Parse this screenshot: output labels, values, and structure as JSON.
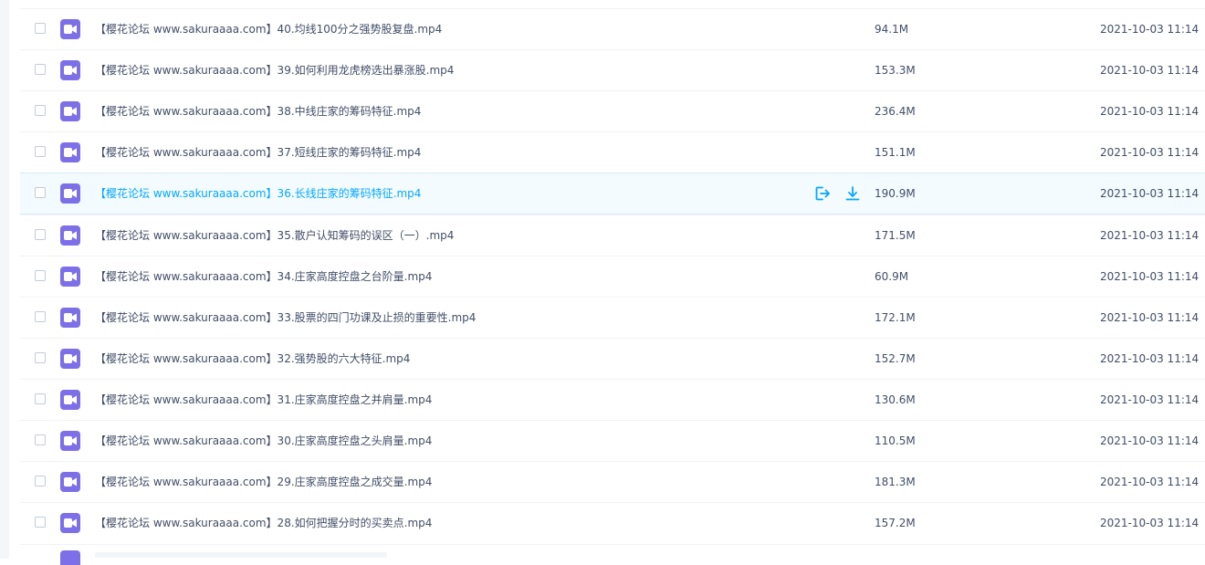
{
  "files": [
    {
      "name": "【樱花论坛 www.sakuraaaa.com】40.均线100分之强势股复盘.mp4",
      "size": "94.1M",
      "date": "2021-10-03 11:14"
    },
    {
      "name": "【樱花论坛 www.sakuraaaa.com】39.如何利用龙虎榜选出暴涨股.mp4",
      "size": "153.3M",
      "date": "2021-10-03 11:14"
    },
    {
      "name": "【樱花论坛 www.sakuraaaa.com】38.中线庄家的筹码特征.mp4",
      "size": "236.4M",
      "date": "2021-10-03 11:14"
    },
    {
      "name": "【樱花论坛 www.sakuraaaa.com】37.短线庄家的筹码特征.mp4",
      "size": "151.1M",
      "date": "2021-10-03 11:14"
    },
    {
      "name": "【樱花论坛 www.sakuraaaa.com】36.长线庄家的筹码特征.mp4",
      "size": "190.9M",
      "date": "2021-10-03 11:14"
    },
    {
      "name": "【樱花论坛 www.sakuraaaa.com】35.散户认知筹码的误区（一）.mp4",
      "size": "171.5M",
      "date": "2021-10-03 11:14"
    },
    {
      "name": "【樱花论坛 www.sakuraaaa.com】34.庄家高度控盘之台阶量.mp4",
      "size": "60.9M",
      "date": "2021-10-03 11:14"
    },
    {
      "name": "【樱花论坛 www.sakuraaaa.com】33.股票的四门功课及止损的重要性.mp4",
      "size": "172.1M",
      "date": "2021-10-03 11:14"
    },
    {
      "name": "【樱花论坛 www.sakuraaaa.com】32.强势股的六大特征.mp4",
      "size": "152.7M",
      "date": "2021-10-03 11:14"
    },
    {
      "name": "【樱花论坛 www.sakuraaaa.com】31.庄家高度控盘之并肩量.mp4",
      "size": "130.6M",
      "date": "2021-10-03 11:14"
    },
    {
      "name": "【樱花论坛 www.sakuraaaa.com】30.庄家高度控盘之头肩量.mp4",
      "size": "110.5M",
      "date": "2021-10-03 11:14"
    },
    {
      "name": "【樱花论坛 www.sakuraaaa.com】29.庄家高度控盘之成交量.mp4",
      "size": "181.3M",
      "date": "2021-10-03 11:14"
    },
    {
      "name": "【樱花论坛 www.sakuraaaa.com】28.如何把握分时的买卖点.mp4",
      "size": "157.2M",
      "date": "2021-10-03 11:14"
    }
  ],
  "hovered_index": 4,
  "hover_actions": [
    {
      "name": "share",
      "icon": "share-icon"
    },
    {
      "name": "download",
      "icon": "download-icon"
    }
  ],
  "colors": {
    "accent": "#06a7ff",
    "video_icon": "#7d6fe8",
    "hover_row": "#f3fbff",
    "text": "#424e67"
  }
}
